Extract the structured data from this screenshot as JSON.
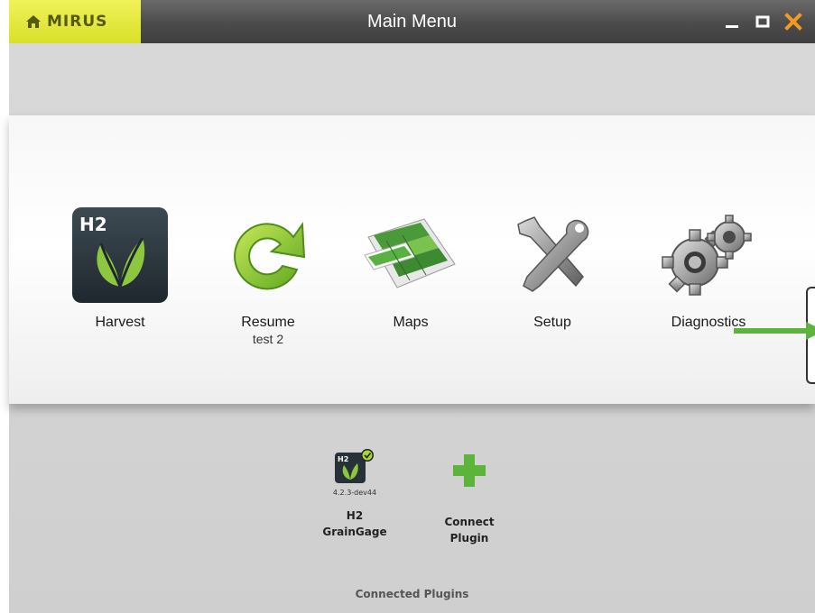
{
  "window": {
    "brand": "MIRUS",
    "title": "Main Menu"
  },
  "menu": {
    "items": [
      {
        "label": "Harvest",
        "sublabel": "",
        "icon": "harvest-h2-icon"
      },
      {
        "label": "Resume",
        "sublabel": "test 2",
        "icon": "resume-icon"
      },
      {
        "label": "Maps",
        "sublabel": "",
        "icon": "maps-icon"
      },
      {
        "label": "Setup",
        "sublabel": "",
        "icon": "setup-icon"
      },
      {
        "label": "Diagnostics",
        "sublabel": "",
        "icon": "diagnostics-icon"
      }
    ]
  },
  "plugins": {
    "items": [
      {
        "version": "4.2.3-dev44",
        "name_line1": "H2",
        "name_line2": "GrainGage",
        "icon": "h2-graingage-icon",
        "status": "connected"
      },
      {
        "version": "",
        "name_line1": "Connect",
        "name_line2": "Plugin",
        "icon": "plus-icon"
      }
    ],
    "caption": "Connected Plugins"
  },
  "colors": {
    "brand_yellow": "#e6ea3a",
    "accent_green": "#5cb53a",
    "close_orange": "#f39a1e",
    "titlebar": "#4b4b4b"
  }
}
